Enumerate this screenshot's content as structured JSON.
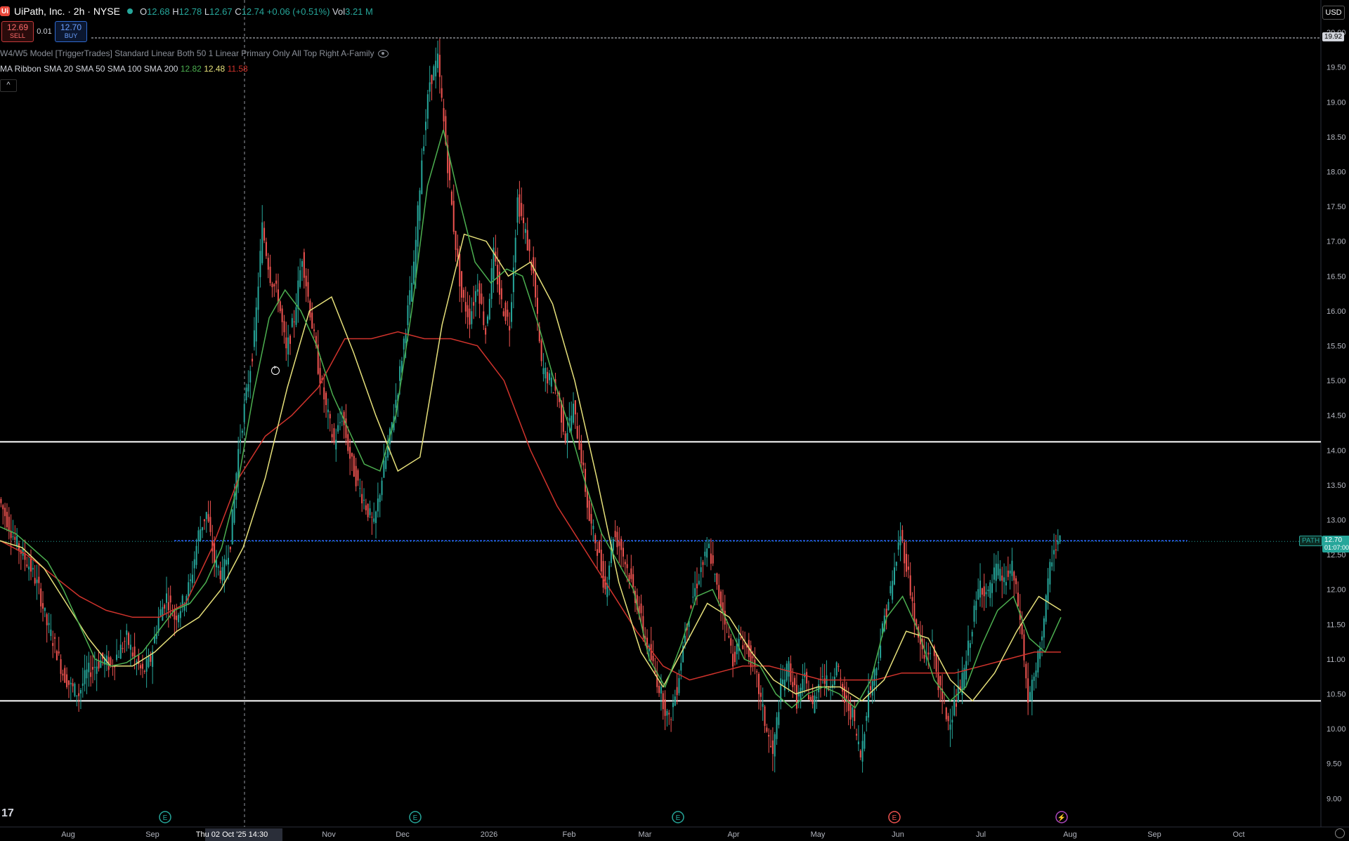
{
  "header": {
    "logo_text": "Ui",
    "symbol_title": "UiPath, Inc. · 2h · NYSE",
    "ohlc": {
      "o_label": "O",
      "o": "12.68",
      "h_label": "H",
      "h": "12.78",
      "l_label": "L",
      "l": "12.67",
      "c_label": "C",
      "c": "12.74",
      "change": "+0.06 (+0.51%)",
      "vol_label": "Vol",
      "vol": "3.21 M"
    }
  },
  "trade": {
    "sell_price": "12.69",
    "sell_label": "SELL",
    "spread": "0.01",
    "buy_price": "12.70",
    "buy_label": "BUY"
  },
  "indicators": {
    "model": "W4/W5 Model [TriggerTrades] Standard Linear Both 50 1 Linear Primary Only All Top Right A-Family",
    "ma_ribbon_label": "MA Ribbon SMA 20 SMA 50 SMA 100 SMA 200",
    "ma_values": [
      "12.82",
      "12.48",
      "11.58"
    ]
  },
  "collapse_label": "^",
  "currency": "USD",
  "price_tags": {
    "top_line": "19.92",
    "symbol_tag": "PATH",
    "last_price": "12.70",
    "countdown": "01:07:00"
  },
  "crosshair_date": "Thu 02 Oct '25",
  "crosshair_time": "14:30",
  "tv_logo": "17",
  "colors": {
    "up": "#26a69a",
    "down": "#ef5350",
    "sma20": "#4caf50",
    "sma50": "#e6e07a",
    "sma200": "#d0332c",
    "blue_line": "#2962ff",
    "background": "#000000"
  },
  "chart_data": {
    "type": "candlestick",
    "ylim": [
      8.75,
      20.0
    ],
    "y_ticks": [
      "20.00",
      "19.50",
      "19.00",
      "18.50",
      "18.00",
      "17.50",
      "17.00",
      "16.50",
      "16.00",
      "15.50",
      "15.00",
      "14.50",
      "14.00",
      "13.50",
      "13.00",
      "12.50",
      "12.00",
      "11.50",
      "11.00",
      "10.50",
      "10.00",
      "9.50",
      "9.00"
    ],
    "x_ticks": [
      "Aug",
      "Sep",
      "Thu 02 Oct '25   14:30",
      "Nov",
      "Dec",
      "2026",
      "Feb",
      "Mar",
      "Apr",
      "May",
      "Jun",
      "Jul",
      "Aug",
      "Sep",
      "Oct"
    ],
    "horizontal_lines": [
      {
        "price": 19.92,
        "style": "dashed"
      },
      {
        "price": 14.12,
        "style": "solid"
      },
      {
        "price": 10.4,
        "style": "solid"
      },
      {
        "price": 12.7,
        "style": "blue"
      }
    ],
    "event_markers": [
      "E",
      "E",
      "E",
      "E",
      "⚡"
    ],
    "price_path": [
      13.3,
      13.0,
      12.7,
      12.5,
      12.3,
      12.0,
      11.5,
      11.2,
      10.8,
      10.6,
      10.5,
      10.8,
      10.9,
      11.0,
      10.9,
      11.1,
      11.3,
      11.0,
      10.8,
      11.0,
      11.6,
      11.9,
      11.6,
      11.8,
      12.1,
      12.8,
      13.1,
      12.4,
      12.2,
      12.7,
      14.0,
      14.8,
      15.6,
      17.2,
      16.5,
      16.2,
      15.4,
      15.9,
      16.8,
      16.0,
      15.2,
      14.6,
      14.1,
      14.5,
      13.9,
      13.5,
      13.2,
      12.9,
      13.6,
      14.2,
      14.9,
      15.8,
      16.6,
      18.2,
      19.3,
      19.6,
      18.4,
      17.2,
      16.2,
      15.9,
      16.4,
      15.7,
      16.8,
      16.1,
      15.8,
      17.6,
      17.1,
      16.5,
      15.2,
      15.0,
      14.8,
      14.2,
      14.6,
      13.9,
      13.0,
      12.6,
      12.0,
      12.8,
      12.6,
      12.2,
      11.8,
      11.3,
      10.9,
      10.5,
      10.1,
      10.6,
      11.4,
      11.9,
      12.3,
      12.6,
      12.0,
      11.6,
      11.0,
      11.3,
      11.1,
      10.7,
      10.1,
      9.6,
      10.6,
      10.9,
      10.4,
      10.7,
      10.3,
      10.8,
      10.6,
      10.9,
      10.4,
      10.2,
      9.6,
      10.5,
      10.9,
      11.6,
      12.1,
      12.8,
      12.2,
      11.4,
      11.0,
      11.2,
      10.5,
      10.1,
      10.4,
      10.8,
      11.5,
      12.1,
      11.9,
      12.3,
      12.1,
      12.3,
      11.6,
      10.4,
      10.8,
      11.6,
      12.5,
      12.74
    ],
    "sma20": [
      12.9,
      12.8,
      12.6,
      12.4,
      12.0,
      11.5,
      11.0,
      10.9,
      10.95,
      11.1,
      11.4,
      11.7,
      11.8,
      12.1,
      12.6,
      13.5,
      14.8,
      15.9,
      16.3,
      16.0,
      15.5,
      14.8,
      14.3,
      13.8,
      13.7,
      14.5,
      16.0,
      17.8,
      18.6,
      17.6,
      16.7,
      16.4,
      16.6,
      16.5,
      15.8,
      15.0,
      14.3,
      13.5,
      12.8,
      12.4,
      12.0,
      11.0,
      10.6,
      11.2,
      11.9,
      12.0,
      11.5,
      11.0,
      10.9,
      10.5,
      10.3,
      10.5,
      10.6,
      10.5,
      10.3,
      10.7,
      11.6,
      11.9,
      11.4,
      10.7,
      10.4,
      10.6,
      11.2,
      11.7,
      11.9,
      11.3,
      11.1,
      11.6
    ],
    "sma50": [
      12.7,
      12.6,
      12.3,
      11.8,
      11.3,
      10.9,
      10.9,
      11.1,
      11.4,
      11.6,
      12.0,
      12.6,
      13.6,
      14.9,
      16.0,
      16.2,
      15.4,
      14.5,
      13.7,
      13.9,
      15.8,
      17.1,
      17.0,
      16.5,
      16.7,
      16.1,
      15.0,
      13.6,
      12.1,
      11.1,
      10.6,
      11.2,
      11.8,
      11.6,
      11.1,
      10.7,
      10.5,
      10.6,
      10.6,
      10.4,
      10.7,
      11.4,
      11.3,
      10.7,
      10.4,
      10.8,
      11.4,
      11.9,
      11.7
    ],
    "sma200": [
      12.7,
      12.5,
      12.2,
      11.9,
      11.7,
      11.6,
      11.6,
      11.8,
      12.6,
      13.6,
      14.2,
      14.5,
      14.9,
      15.6,
      15.6,
      15.7,
      15.6,
      15.6,
      15.5,
      15.0,
      14.0,
      13.2,
      12.6,
      12.0,
      11.4,
      10.9,
      10.7,
      10.8,
      10.9,
      10.9,
      10.8,
      10.7,
      10.7,
      10.7,
      10.8,
      10.8,
      10.8,
      10.9,
      11.0,
      11.1,
      11.1
    ]
  }
}
